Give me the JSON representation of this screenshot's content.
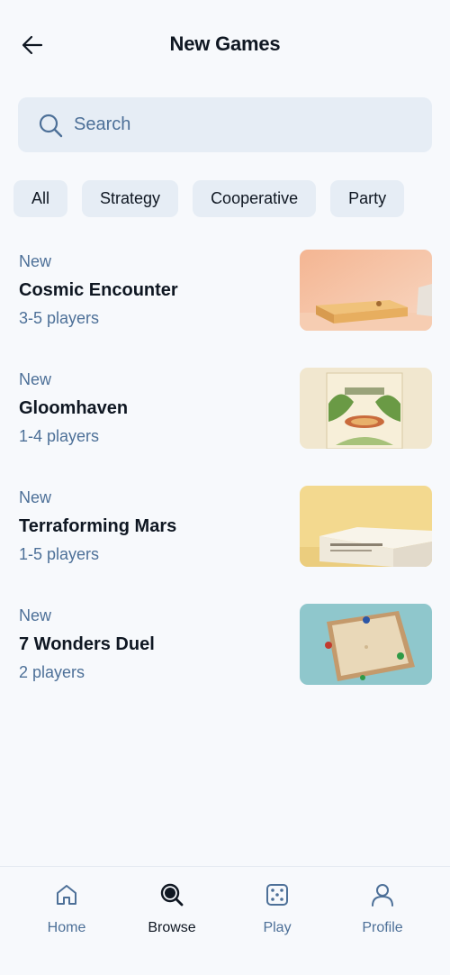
{
  "header": {
    "title": "New Games",
    "back_icon": "arrow-left-icon"
  },
  "search": {
    "placeholder": "Search",
    "value": "",
    "icon": "search-icon"
  },
  "filters": [
    {
      "label": "All"
    },
    {
      "label": "Strategy"
    },
    {
      "label": "Cooperative"
    },
    {
      "label": "Party"
    }
  ],
  "games": [
    {
      "tag": "New",
      "name": "Cosmic Encounter",
      "players": "3-5 players"
    },
    {
      "tag": "New",
      "name": "Gloomhaven",
      "players": "1-4 players"
    },
    {
      "tag": "New",
      "name": "Terraforming Mars",
      "players": "1-5 players"
    },
    {
      "tag": "New",
      "name": "7 Wonders Duel",
      "players": "2 players"
    }
  ],
  "bottom_nav": {
    "active": "Browse",
    "items": [
      {
        "label": "Home",
        "icon": "home-icon"
      },
      {
        "label": "Browse",
        "icon": "search-icon"
      },
      {
        "label": "Play",
        "icon": "dice-icon"
      },
      {
        "label": "Profile",
        "icon": "user-icon"
      }
    ]
  },
  "colors": {
    "background": "#f7f9fc",
    "surface": "#e6edf5",
    "text_primary": "#0f1722",
    "text_secondary": "#4d7098"
  }
}
